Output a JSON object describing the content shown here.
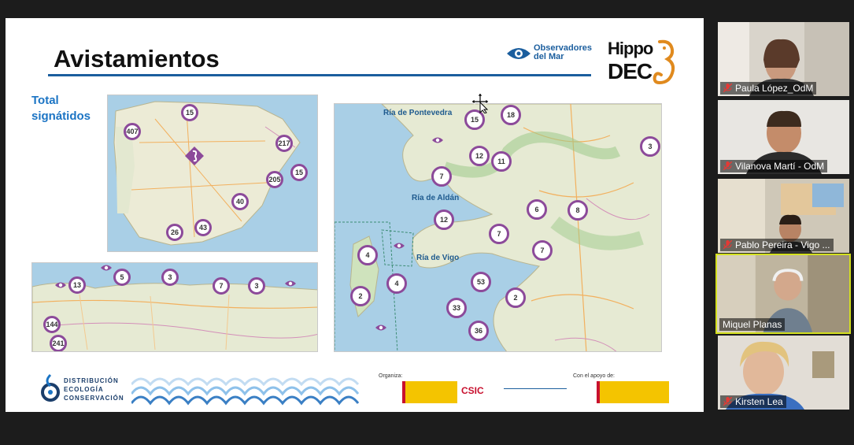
{
  "slide": {
    "title": "Avistamientos",
    "odm_logo_text": "Observadores\ndel Mar",
    "hippo_top": "Hippo",
    "hippo_bottom": "DEC",
    "total_label_line1": "Total",
    "total_label_line2": "signátidos",
    "spain_map": {
      "markers": [
        "15",
        "407",
        "217",
        "15",
        "205",
        "40",
        "43",
        "26"
      ],
      "has_eye_marker": true
    },
    "north_map": {
      "markers": [
        "13",
        "5",
        "3",
        "7",
        "3",
        "144",
        "241"
      ]
    },
    "rias_map": {
      "labels": [
        "Ría de Pontevedra",
        "Ría de Aldán",
        "Ría de Vigo"
      ],
      "markers": [
        "15",
        "18",
        "12",
        "11",
        "3",
        "7",
        "12",
        "6",
        "8",
        "7",
        "7",
        "4",
        "4",
        "2",
        "53",
        "2",
        "33",
        "36"
      ]
    },
    "footer": {
      "dec_text": "DISTRIBUCIÓN\nECOLOGÍA\nCONSERVACIÓN",
      "organiza_label": "Organiza:",
      "csic_label": "CSIC",
      "apoyo_label": "Con el apoyo de:"
    }
  },
  "participants": [
    {
      "name": "Paula López_OdM",
      "muted": true,
      "active": false
    },
    {
      "name": "Vilanova Martí - OdM",
      "muted": true,
      "active": false
    },
    {
      "name": "Pablo Pereira - Vigo ...",
      "muted": true,
      "active": false
    },
    {
      "name": "Miquel Planas",
      "muted": false,
      "active": true
    },
    {
      "name": "Kirsten Lea",
      "muted": true,
      "active": false
    }
  ],
  "colors": {
    "accent_blue": "#1b5e9e",
    "marker_purple": "#8c4a9a",
    "active_speaker": "#d4e01e",
    "mute_red": "#e53935"
  }
}
